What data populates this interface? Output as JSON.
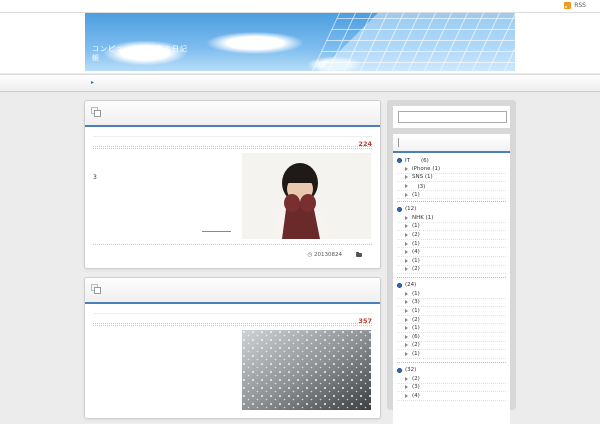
{
  "topbar": {
    "rss_label": "RSS"
  },
  "header": {
    "site_title_line1": "コンピュータと仕事の日記",
    "site_title_line2": "帳"
  },
  "posts": [
    {
      "views": "224",
      "excerpt": "3",
      "date": "20130824"
    },
    {
      "views": "357"
    }
  ],
  "sidebar": {
    "search_placeholder": "",
    "categories": [
      {
        "title": "IT　　(6)",
        "items": [
          "iPhone (1)",
          "SNS (1)",
          "　(3)",
          "(1)"
        ]
      },
      {
        "title": "(12)",
        "items": [
          "NHK (1)",
          "(1)",
          "(2)",
          "(1)",
          "(4)",
          "(1)",
          "(2)"
        ]
      },
      {
        "title": "(24)",
        "items": [
          "(1)",
          "(3)",
          "(1)",
          "(2)",
          "(1)",
          "(6)",
          "(2)",
          "(1)"
        ]
      },
      {
        "title": "(32)",
        "items": [
          "(2)",
          "(3)",
          "(4)"
        ]
      }
    ]
  },
  "colors": {
    "accent": "#4a7fb8",
    "views": "#c0392b",
    "rss": "#f39a1e"
  },
  "icons": [
    "rss-icon",
    "post-icon",
    "clock-icon",
    "folder-icon",
    "category-bullet-icon",
    "triangle-icon"
  ]
}
